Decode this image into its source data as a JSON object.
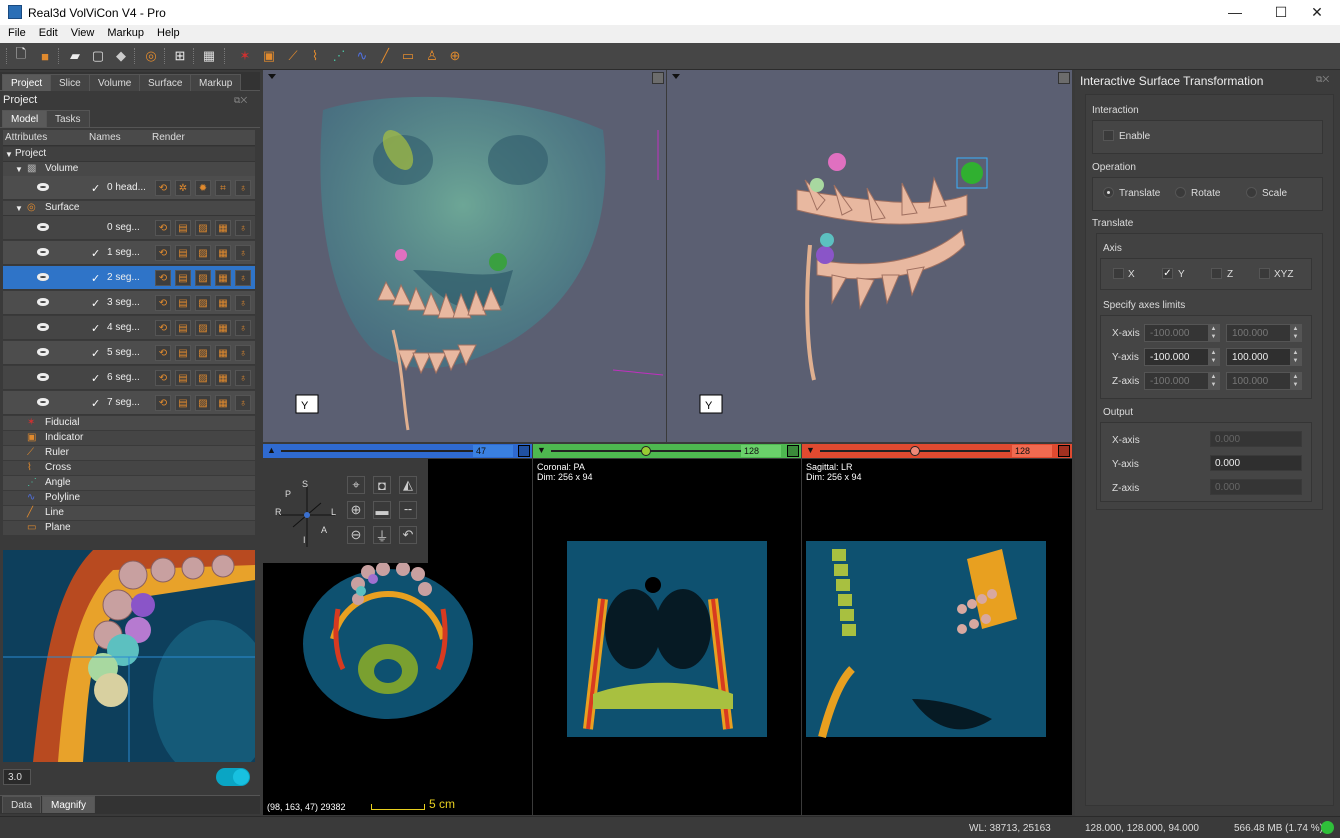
{
  "window": {
    "title": "Real3d VolViCon V4 - Pro",
    "min": "—",
    "max": "☐",
    "close": "✕"
  },
  "menu": [
    "File",
    "Edit",
    "View",
    "Markup",
    "Help"
  ],
  "left": {
    "tabs": [
      "Project",
      "Slice",
      "Volume",
      "Surface",
      "Markup"
    ],
    "panel_title": "Project",
    "subtabs": [
      "Model",
      "Tasks"
    ],
    "headers": [
      "Attributes",
      "Names",
      "Render"
    ],
    "root": "Project",
    "volume_group": "Volume",
    "volume_item": "0 head...",
    "surface_group": "Surface",
    "surfaces": [
      "0 seg...",
      "1 seg...",
      "2 seg...",
      "3 seg...",
      "4 seg...",
      "5 seg...",
      "6 seg...",
      "7 seg..."
    ],
    "markups": [
      "Fiducial",
      "Indicator",
      "Ruler",
      "Cross",
      "Angle",
      "Polyline",
      "Line",
      "Plane"
    ],
    "magnify_value": "3.0",
    "bottom_tabs": [
      "Data",
      "Magnify"
    ]
  },
  "views": {
    "axial_value": "47",
    "coronal_value": "128",
    "sagittal_value": "128",
    "coronal_label": "Coronal: PA",
    "coronal_dim": "Dim: 256 x 94",
    "sagittal_label": "Sagittal: LR",
    "sagittal_dim": "Dim: 256 x 94",
    "axial_coords": "(98, 163, 47) 29382",
    "scale_label": "5 cm",
    "orient": {
      "S": "S",
      "P": "P",
      "R": "R",
      "L": "L",
      "A": "A",
      "I": "I"
    }
  },
  "right": {
    "title": "Interactive Surface Transformation",
    "interaction": "Interaction",
    "enable": "Enable",
    "operation": "Operation",
    "translate": "Translate",
    "rotate": "Rotate",
    "scale": "Scale",
    "translate_section": "Translate",
    "axis": "Axis",
    "axes": [
      "X",
      "Y",
      "Z",
      "XYZ"
    ],
    "limits_title": "Specify axes limits",
    "limits": [
      {
        "label": "X-axis",
        "min": "-100.000",
        "max": "100.000"
      },
      {
        "label": "Y-axis",
        "min": "-100.000",
        "max": "100.000"
      },
      {
        "label": "Z-axis",
        "min": "-100.000",
        "max": "100.000"
      }
    ],
    "output": "Output",
    "outputs": [
      {
        "label": "X-axis",
        "value": "0.000"
      },
      {
        "label": "Y-axis",
        "value": "0.000"
      },
      {
        "label": "Z-axis",
        "value": "0.000"
      }
    ]
  },
  "status": {
    "wl": "WL: 38713, 25163",
    "pos": "128.000, 128.000, 94.000",
    "mem": "566.48 MB (1.74 %)"
  }
}
